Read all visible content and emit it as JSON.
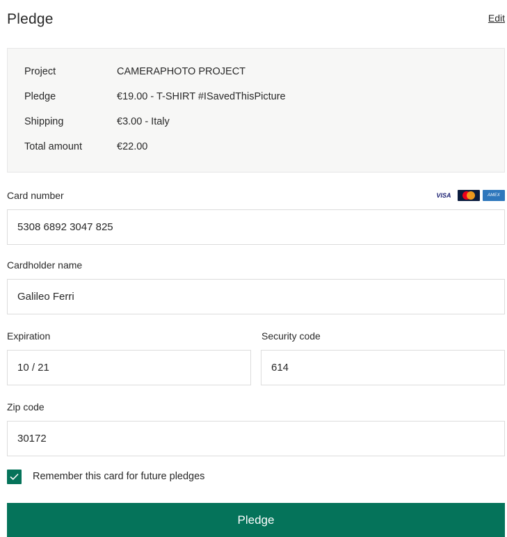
{
  "header": {
    "title": "Pledge",
    "edit_label": "Edit"
  },
  "summary": {
    "rows": [
      {
        "label": "Project",
        "value": "CAMERAPHOTO PROJECT"
      },
      {
        "label": "Pledge",
        "value": "€19.00 - T-SHIRT #ISavedThisPicture"
      },
      {
        "label": "Shipping",
        "value": "€3.00 - Italy"
      },
      {
        "label": "Total amount",
        "value": "€22.00"
      }
    ]
  },
  "form": {
    "card_number": {
      "label": "Card number",
      "value": "5308 6892 3047 825"
    },
    "card_logos": {
      "visa": "VISA",
      "mastercard": "mastercard-logo",
      "amex": "AMEX"
    },
    "cardholder": {
      "label": "Cardholder name",
      "value": "Galileo Ferri"
    },
    "expiration": {
      "label": "Expiration",
      "value": "10 / 21"
    },
    "security_code": {
      "label": "Security code",
      "value": "614"
    },
    "zip": {
      "label": "Zip code",
      "value": "30172"
    },
    "remember": {
      "label": "Remember this card for future pledges",
      "checked": true
    },
    "submit_label": "Pledge"
  },
  "colors": {
    "accent": "#05735a",
    "summary_bg": "#f7f7f6",
    "border": "#dcdcdc",
    "text": "#282828"
  }
}
